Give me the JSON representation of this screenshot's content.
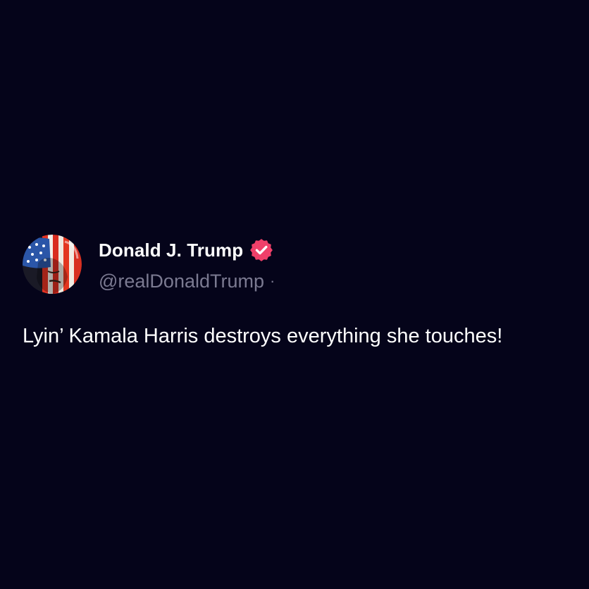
{
  "post": {
    "author": {
      "display_name": "Donald J. Trump",
      "handle": "@realDonaldTrump",
      "verified": true,
      "verified_badge_color": "#f0406a",
      "avatar_icon": "flag-portrait-avatar"
    },
    "separator": "·",
    "timestamp": "",
    "text": "Lyin’ Kamala Harris destroys everything she touches!"
  },
  "colors": {
    "background": "#05041a",
    "primary_text": "#ffffff",
    "secondary_text": "#7b7a91",
    "accent": "#f0406a"
  }
}
